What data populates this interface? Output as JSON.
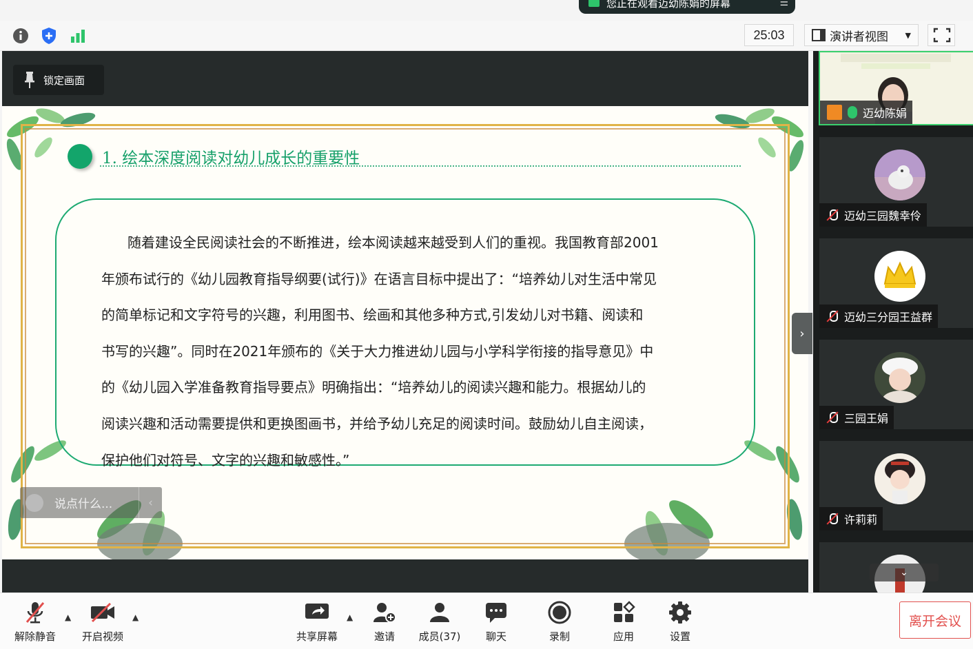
{
  "banner": {
    "text": "您正在观看迈幼陈娟的屏幕",
    "more_icon": "menu-icon"
  },
  "topbar": {
    "timer": "25:03",
    "view_label": "演讲者视图",
    "icons": [
      "info-icon",
      "shield-icon",
      "signal-icon",
      "fullscreen-icon"
    ],
    "accent": "#2a6ef5",
    "signal_color": "#2ec46b"
  },
  "stage": {
    "lock_label": "锁定画面",
    "slide": {
      "heading": "1. 绘本深度阅读对幼儿成长的重要性",
      "lines": [
        "随着建设全民阅读社会的不断推进，绘本阅读越来越受到人们的重视。我国教育部2001",
        "年颁布试行的《幼儿园教育指导纲要(试行)》在语言目标中提出了：“培养幼儿对生活中常见",
        "的简单标记和文字符号的兴趣，利用图书、绘画和其他多种方式,引发幼儿对书籍、阅读和",
        "书写的兴趣”。同时在2021年颁布的《关于大力推进幼儿园与小学科学衔接的指导意见》中",
        "的《幼儿园入学准备教育指导要点》明确指出：“培养幼儿的阅读兴趣和能力。根据幼儿的",
        "阅读兴趣和活动需要提供和更换图画书，并给予幼儿充足的阅读时间。鼓励幼儿自主阅读，",
        "保护他们对符号、文字的兴趣和敏感性。”"
      ],
      "accent": "#16a06a",
      "frame_color": "#e0b347"
    },
    "chat_placeholder": "说点什么..."
  },
  "participants": [
    {
      "name": "迈幼陈娟",
      "mic": "on",
      "presenter": true
    },
    {
      "name": "迈幼三园魏幸伶",
      "mic": "off"
    },
    {
      "name": "迈幼三分园王益群",
      "mic": "off"
    },
    {
      "name": "三园王娟",
      "mic": "off"
    },
    {
      "name": "许莉莉",
      "mic": "off"
    }
  ],
  "toolbar": {
    "unmute": "解除静音",
    "start_video": "开启视频",
    "share": "共享屏幕",
    "invite": "邀请",
    "members": "成员(37)",
    "chat": "聊天",
    "record": "录制",
    "apps": "应用",
    "settings": "设置",
    "leave": "离开会议",
    "danger_color": "#e2504e"
  }
}
